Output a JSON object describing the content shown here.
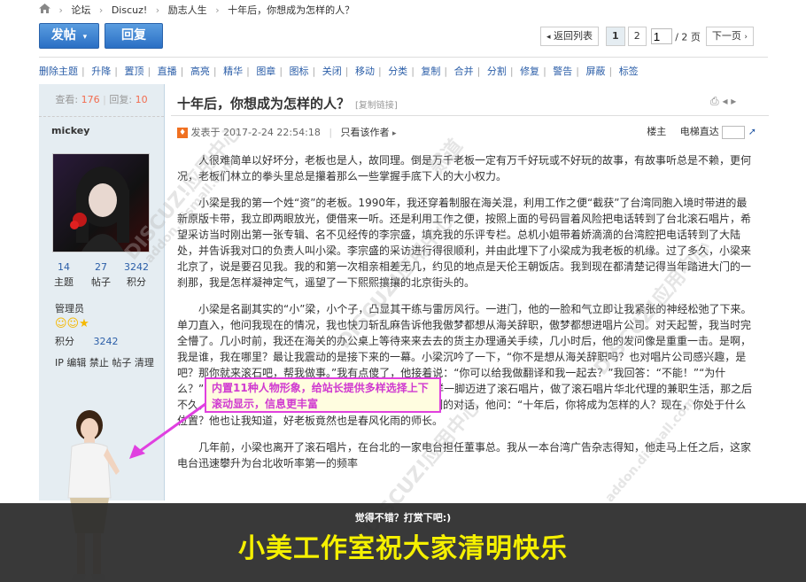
{
  "breadcrumb": [
    "论坛",
    "Discuz!",
    "励志人生",
    "十年后，你想成为怎样的人？"
  ],
  "buttons": {
    "post": "发帖",
    "reply": "回复"
  },
  "pager": {
    "back": "返回列表",
    "page1": "1",
    "page2": "2",
    "current": "1",
    "total": "/ 2 页",
    "next": "下一页"
  },
  "toolbar": [
    "删除主题",
    "升降",
    "置顶",
    "直播",
    "高亮",
    "精华",
    "图章",
    "图标",
    "关闭",
    "移动",
    "分类",
    "复制",
    "合并",
    "分割",
    "修复",
    "警告",
    "屏蔽",
    "标签"
  ],
  "stats": {
    "views_label": "查看:",
    "views": "176",
    "replies_label": "回复:",
    "replies": "10"
  },
  "author": {
    "name": "mickey",
    "topics": "14",
    "topics_label": "主题",
    "posts": "27",
    "posts_label": "帖子",
    "credits": "3242",
    "credits_label": "积分",
    "group": "管理员",
    "credit_label": "积分",
    "credit_value": "3242",
    "admin_links": "IP 编辑 禁止 帖子 清理"
  },
  "post": {
    "title": "十年后，你想成为怎样的人？",
    "copy_link": "[复制链接]",
    "posted_at": "发表于 2017-2-24 22:54:18",
    "author_only": "只看该作者",
    "floor": "楼主",
    "goto": "电梯直达",
    "paragraphs": [
      "人很难简单以好坏分，老板也是人，故同理。倒是万千老板一定有万千好玩或不好玩的故事，有故事听总是不赖，更何况，老板们林立的拳头里总是攥着那么一些掌握手底下人的大小权力。",
      "小梁是我的第一个姓“资”的老板。1990年，我还穿着制服在海关混，利用工作之便“截获”了台湾同胞入境时带进的最新原版卡带，我立即两眼放光，便借来一听。还是利用工作之便，按照上面的号码冒着风险把电话转到了台北滚石唱片，希望采访当时刚出第一张专辑、名不见经传的李宗盛，填充我的乐评专栏。总机小姐带着娇滴滴的台湾腔把电话转到了大陆处，并告诉我对口的负责人叫小梁。李宗盛的采访进行得很顺利，并由此埋下了小梁成为我老板的机缘。过了多久，小梁来北京了，说是要召见我。我的和第一次相亲相差无几，约见的地点是天伦王朝饭店。我到现在都清楚记得当年踏进大门的一刹那，我是怎样凝神定气，遥望了一下熙熙攘攘的北京街头的。",
      "小梁是名副其实的“小”梁，小个子，凸显其干练与雷厉风行。一进门，他的一脸和气立即让我紧张的神经松弛了下来。单刀直入，他问我现在的情况，我也快刀斩乱麻告诉他我傲梦都想从海关辞职，傲梦都想进唱片公司。对天起誓，我当时完全懵了。几小时前，我还在海关的办公桌上等待来来去去的货主办理通关手续，几小时后，他的发问像是重重一击。是啊，我是谁，我在哪里？最让我震动的是接下来的一幕。小梁沉吟了一下，“你不是想从海关辞职吗？也对唱片公司感兴趣，是吧？那你就来滚石吧，帮我做事。”我有点傻了，他接着说：“你可以给我做翻译和我一起去？”我回答：“不能！”“为什么？”“我英文不灵！”“那好，你就来做宣传吧。”我就这样一脚迈进了滚石唱片，做了滚石唱片华北代理的兼职生活，那之后不久，我从海关辞了职。这么多年，我时常会想起那一刻的对话，他问：“十年后，你将成为怎样的人？现在，你处于什么位置？他也让我知道，好老板竟然也是春风化雨的师长。",
      "几年前，小梁也离开了滚石唱片，在台北的一家电台担任董事总。我从一本台湾广告杂志得知，他走马上任之后，这家电台迅速攀升为台北收听率第一的频率"
    ]
  },
  "tooltip": "内置11种人物形象，给站长提供多样选择上下滚动显示，信息更丰富",
  "banner": {
    "sub": "觉得不错？打赏下吧:)",
    "main": "小美工作室祝大家清明快乐"
  },
  "watermark": [
    "DISCUZ!应用中心",
    "addon.dismall.com",
    "贰道"
  ],
  "colors": {
    "accent": "#2b5ea8",
    "button": "#3a80d0",
    "sidebar": "#e5edf2",
    "highlight": "#f26c4f",
    "banner_text": "#f5f000",
    "tooltip_border": "#e040e0"
  }
}
